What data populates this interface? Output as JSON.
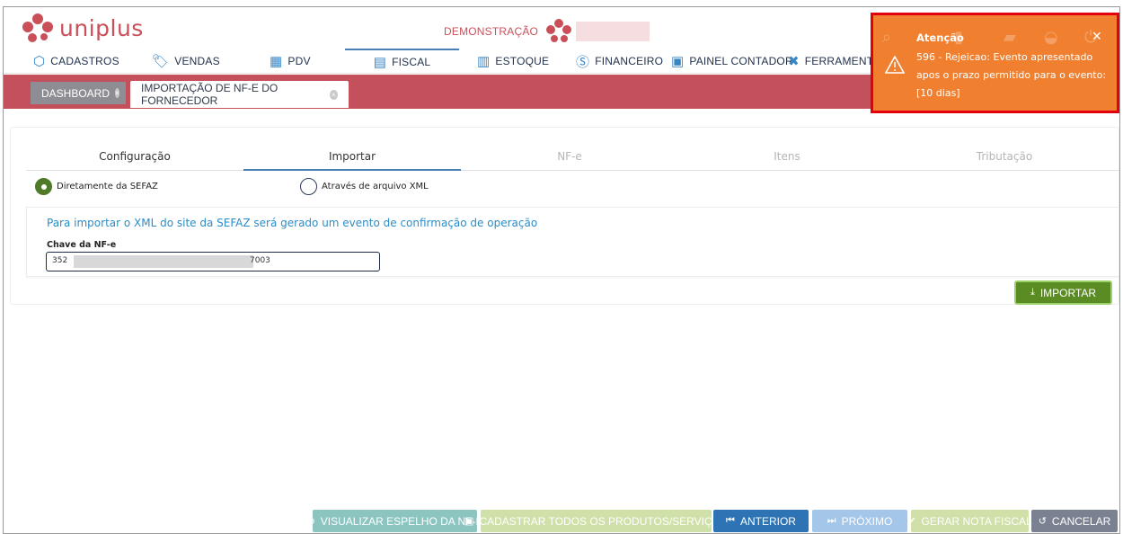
{
  "app": {
    "logo_text": "uniplus",
    "environment_label": "DEMONSTRAÇÃO"
  },
  "menu": [
    {
      "label": "CADASTROS",
      "icon": "hexagon-icon"
    },
    {
      "label": "VENDAS",
      "icon": "tag-icon"
    },
    {
      "label": "PDV",
      "icon": "cash-register-icon"
    },
    {
      "label": "FISCAL",
      "icon": "document-icon"
    },
    {
      "label": "ESTOQUE",
      "icon": "box-icon"
    },
    {
      "label": "FINANCEIRO",
      "icon": "dollar-icon"
    },
    {
      "label": "PAINEL CONTADOR",
      "icon": "accountant-icon"
    },
    {
      "label": "FERRAMENTAS",
      "icon": "tools-icon"
    }
  ],
  "tabs": [
    {
      "label": "DASHBOARD"
    },
    {
      "label": "IMPORTAÇÃO DE NF-E DO FORNECEDOR"
    }
  ],
  "steps": [
    "Configuração",
    "Importar",
    "NF-e",
    "Itens",
    "Tributação"
  ],
  "source_options": [
    {
      "label": "Diretamente da SEFAZ",
      "selected": true
    },
    {
      "label": "Através de arquivo XML",
      "selected": false
    }
  ],
  "import_panel": {
    "message": "Para importar o XML do site da SEFAZ será gerado um evento de confirmação de operação",
    "key_label": "Chave da NF-e",
    "key_value_start": "352",
    "key_value_end": "7003"
  },
  "import_button": "IMPORTAR",
  "footer": {
    "preview": "VISUALIZAR ESPELHO DA NF-E",
    "register_all": "CADASTRAR TODOS OS PRODUTOS/SERVIÇOS",
    "previous": "ANTERIOR",
    "next": "PRÓXIMO",
    "generate": "GERAR NOTA FISCAL",
    "cancel": "CANCELAR"
  },
  "toast": {
    "title": "Atenção",
    "message": "596 - Rejeicao: Evento apresentado apos o prazo permitido para o evento: [10 dias]"
  },
  "colors": {
    "brand": "#c94f59",
    "tabbar": "#c3505b",
    "import_button": "#5a8c23",
    "toast": "#f08030",
    "toast_border": "#e3000e",
    "nav_blue": "#2e74b5"
  }
}
